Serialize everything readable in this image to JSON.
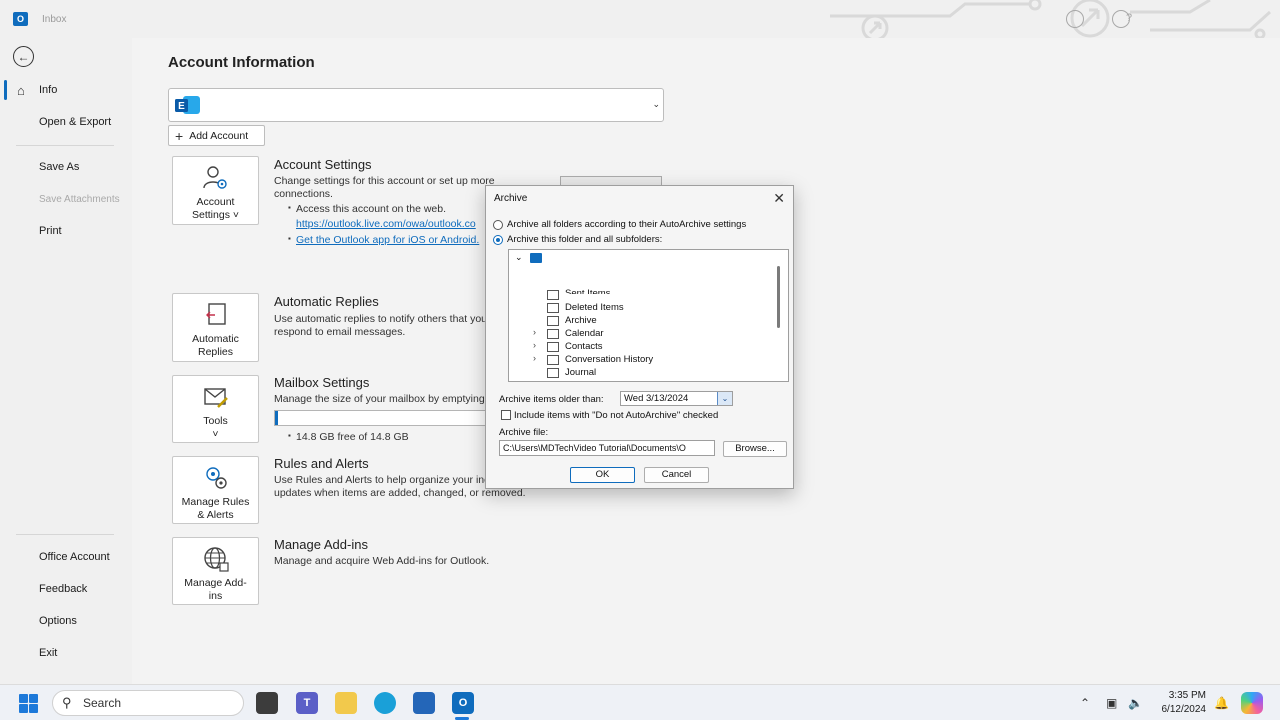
{
  "window": {
    "title": "Inbox"
  },
  "nav": {
    "info": "Info",
    "open_export": "Open & Export",
    "save_as": "Save As",
    "save_attachments": "Save Attachments",
    "print": "Print",
    "office_account": "Office Account",
    "feedback": "Feedback",
    "options": "Options",
    "exit": "Exit"
  },
  "main": {
    "title": "Account Information",
    "add_account": "Add Account",
    "account_settings": {
      "tile_line1": "Account",
      "tile_line2": "Settings ˅",
      "title": "Account Settings",
      "desc1": "Change settings for this account or set up more",
      "desc2": "connections.",
      "bullet1": "Access this account on the web.",
      "link1": "https://outlook.live.com/owa/outlook.co",
      "link2": "Get the Outlook app for iOS or Android."
    },
    "automatic_replies": {
      "tile_line1": "Automatic",
      "tile_line2": "Replies",
      "title": "Automatic Replies",
      "desc1": "Use automatic replies to notify others that you",
      "desc2": "respond to email messages."
    },
    "mailbox_settings": {
      "tile_line1": "Tools",
      "tile_line2": "˅",
      "title": "Mailbox Settings",
      "desc1": "Manage the size of your mailbox by emptying",
      "quota": "14.8 GB free of 14.8 GB",
      "used_fraction": 0.01
    },
    "rules_alerts": {
      "tile_line1": "Manage Rules",
      "tile_line2": "& Alerts",
      "title": "Rules and Alerts",
      "desc1": "Use Rules and Alerts to help organize your inc",
      "desc2": "updates when items are added, changed, or removed."
    },
    "addins": {
      "tile_line1": "Manage Add-",
      "tile_line2": "ins",
      "title": "Manage Add-ins",
      "desc1": "Manage and acquire Web Add-ins for Outlook."
    }
  },
  "dialog": {
    "title": "Archive",
    "radio1": "Archive all folders according to their AutoArchive settings",
    "radio2": "Archive this folder and all subfolders:",
    "tree": [
      "Sent Items",
      "Deleted Items",
      "Archive",
      "Calendar",
      "Contacts",
      "Conversation History",
      "Journal"
    ],
    "older_than_label": "Archive items older than:",
    "older_than_value": "Wed 3/13/2024",
    "include_label": "Include items with \"Do not AutoArchive\" checked",
    "file_label": "Archive file:",
    "file_value": "C:\\Users\\MDTechVideo Tutorial\\Documents\\O",
    "browse": "Browse...",
    "ok": "OK",
    "cancel": "Cancel"
  },
  "taskbar": {
    "search": "Search",
    "time": "3:35 PM",
    "date": "6/12/2024"
  },
  "colors": {
    "accent": "#0f6cbd"
  }
}
